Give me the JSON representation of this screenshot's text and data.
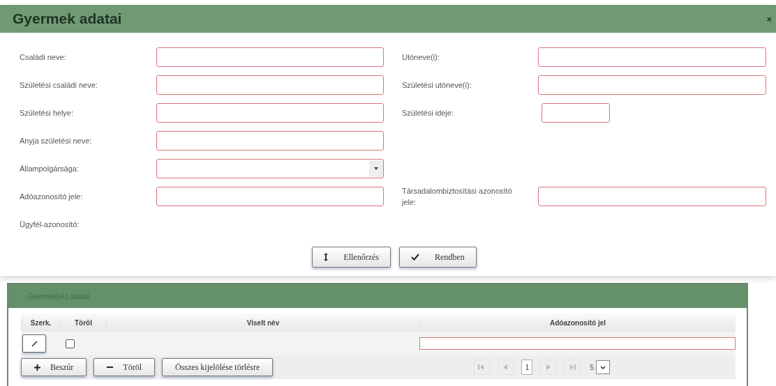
{
  "dialog": {
    "title": "Gyermek adatai",
    "close": "×"
  },
  "form": {
    "rows": [
      {
        "left": {
          "label": "Családi neve:",
          "kind": "text",
          "invalid": true
        },
        "right": {
          "label": "Utóneve(i):",
          "kind": "text",
          "invalid": true
        }
      },
      {
        "left": {
          "label": "Születési családi neve:",
          "kind": "text",
          "invalid": true
        },
        "right": {
          "label": "Születési utóneve(i):",
          "kind": "text",
          "invalid": true
        }
      },
      {
        "left": {
          "label": "Születési helye:",
          "kind": "text",
          "invalid": true
        },
        "right": {
          "label": "Születési ideje:",
          "kind": "date",
          "invalid": true
        }
      },
      {
        "left": {
          "label": "Anyja születési neve:",
          "kind": "text",
          "invalid": true
        }
      },
      {
        "left": {
          "label": "Állampolgársága:",
          "kind": "select",
          "invalid": true
        }
      },
      {
        "left": {
          "label": "Adóazonosító jele:",
          "kind": "text",
          "invalid": true
        },
        "right": {
          "label": "Társadalombiztosítási azonosító jele:",
          "kind": "text",
          "invalid": true
        }
      },
      {
        "left": {
          "label": "Ügyfél-azonosító:",
          "kind": "label"
        }
      }
    ]
  },
  "buttons": [
    {
      "label": "Ellenőrzés",
      "kind": "updown"
    },
    {
      "label": "Rendben",
      "kind": "check"
    }
  ],
  "panel": {
    "title": "Gyermek(ek) adatai",
    "table": {
      "columns": [
        "Szerk.",
        "Töröl",
        "Viselt név",
        "Adóazonosító jel"
      ],
      "rows": [
        {
          "checked": false,
          "tax_id_invalid": true
        }
      ]
    },
    "actions": [
      {
        "label": "Beszúr",
        "kind": "plus"
      },
      {
        "label": "Töröl",
        "kind": "minus"
      },
      {
        "label": "Összes kijelölése törlésre",
        "kind": "text"
      }
    ],
    "pager": {
      "page": "1",
      "page_size": "5"
    }
  }
}
